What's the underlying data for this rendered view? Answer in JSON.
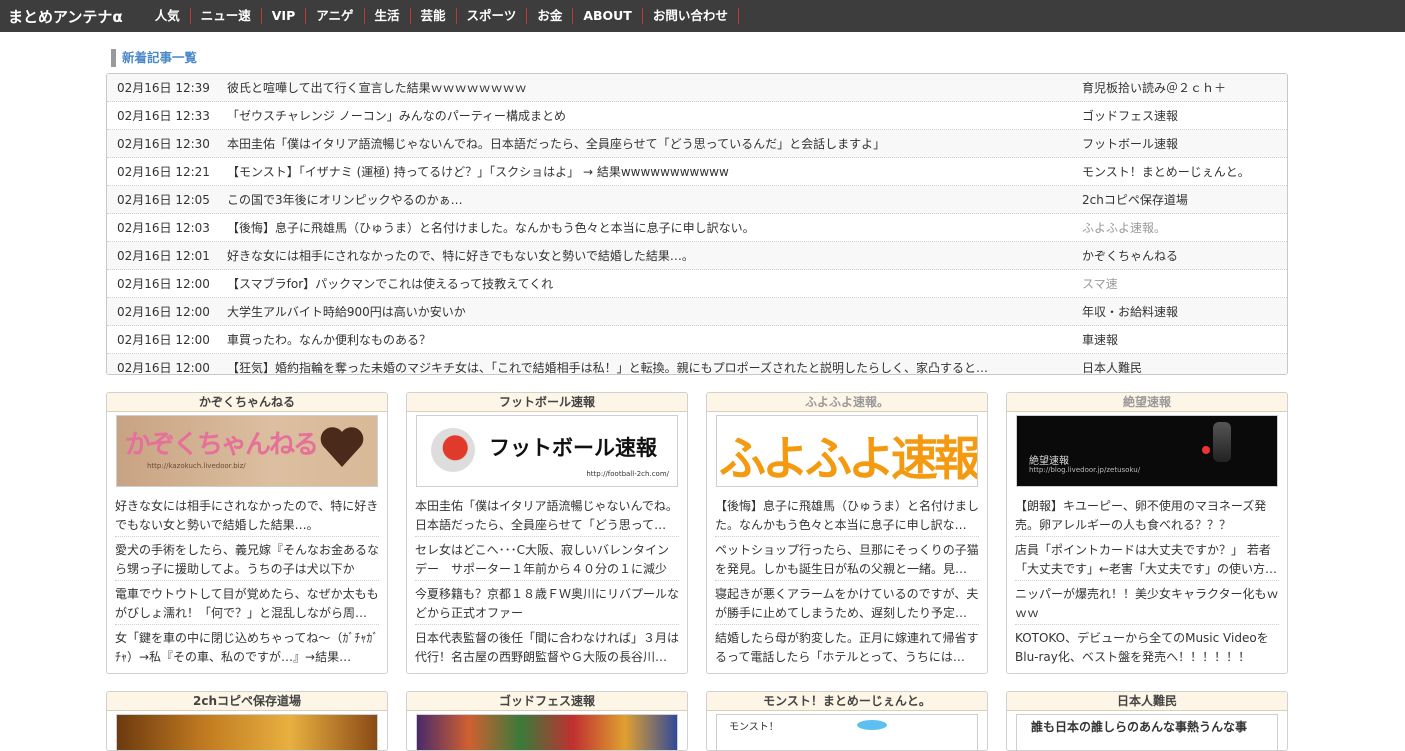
{
  "header": {
    "logo": "まとめアンテナα",
    "nav": [
      "人気",
      "ニュー速",
      "VIP",
      "アニゲ",
      "生活",
      "芸能",
      "スポーツ",
      "お金",
      "ABOUT",
      "お問い合わせ"
    ]
  },
  "section_title": "新着記事一覧",
  "news": [
    {
      "time": "02月16日 12:39",
      "title": "彼氏と喧嘩して出て行く宣言した結果ｗｗｗｗｗｗｗｗ",
      "site": "育児板拾い読み＠２ｃｈ＋"
    },
    {
      "time": "02月16日 12:33",
      "title": "「ゼウスチャレンジ ノーコン」みんなのパーティー構成まとめ",
      "site": "ゴッドフェス速報"
    },
    {
      "time": "02月16日 12:30",
      "title": "本田圭佑「僕はイタリア語流暢じゃないんでね。日本語だったら、全員座らせて「どう思っているんだ」と会話しますよ」",
      "site": "フットボール速報"
    },
    {
      "time": "02月16日 12:21",
      "title": "【モンスト】「イザナミ (運極) 持ってるけど？」「スクショはよ」 → 結果wwwwwwwwwww",
      "site": "モンスト！まとめーじぇんと。"
    },
    {
      "time": "02月16日 12:05",
      "title": "この国で3年後にオリンピックやるのかぁ…",
      "site": "2chコピペ保存道場"
    },
    {
      "time": "02月16日 12:03",
      "title": "【後悔】息子に飛雄馬（ひゅうま）と名付けました。なんかもう色々と本当に息子に申し訳ない。",
      "site": "ふよふよ速報。"
    },
    {
      "time": "02月16日 12:01",
      "title": "好きな女には相手にされなかったので、特に好きでもない女と勢いで結婚した結果…。",
      "site": "かぞくちゃんねる"
    },
    {
      "time": "02月16日 12:00",
      "title": "【スマブラfor】パックマンでこれは使えるって技教えてくれ",
      "site": "スマ速"
    },
    {
      "time": "02月16日 12:00",
      "title": "大学生アルバイト時給900円は高いか安いか",
      "site": "年収・お給料速報"
    },
    {
      "time": "02月16日 12:00",
      "title": "車買ったわ。なんか便利なものある？",
      "site": "車速報"
    },
    {
      "time": "02月16日 12:00",
      "title": "【狂気】婚約指輪を奪った未婚のマジキチ女は、「これで結婚相手は私！」と転換。親にもプロポーズされたと説明したらしく、家凸すると…",
      "site": "日本人難民"
    }
  ],
  "cards": [
    {
      "name": "かぞくちゃんねる",
      "banner_text": "かぞくちゃんねる",
      "banner_url": "http://kazokuch.livedoor.biz/",
      "items": [
        "好きな女には相手にされなかったので、特に好きでもない女と勢いで結婚した結果…。",
        "愛犬の手術をしたら、義兄嫁『そんなお金あるなら甥っ子に援助してよ。うちの子は犬以下か",
        "電車でウトウトして目が覚めたら、なぜか太ももがびしょ濡れ！「何で？」と混乱しながら周…",
        "女「鍵を車の中に閉じ込めちゃってね～（ｶﾞﾁｬｶﾞﾁｬ）→私『その車、私のですが…』→結果…"
      ]
    },
    {
      "name": "フットボール速報",
      "banner_text": "フットボール速報",
      "banner_url": "http://football-2ch.com/",
      "items": [
        "本田圭佑「僕はイタリア語流暢じゃないんでね。日本語だったら、全員座らせて「どう思って…",
        "セレ女はどこへ･･･C大阪、寂しいバレンタインデー　サポーター１年前から４０分の１に減少",
        "今夏移籍も？京都１８歳ＦＷ奥川にリバプールなどから正式オファー",
        "日本代表監督の後任「間に合わなければ」３月は代行！名古屋の西野朗監督やＧ大阪の長谷川…"
      ]
    },
    {
      "name": "ふよふよ速報。",
      "banner_text": "ふよふよ速報。",
      "items": [
        "【後悔】息子に飛雄馬（ひゅうま）と名付けました。なんかもう色々と本当に息子に申し訳な…",
        "ペットショップ行ったら、旦那にそっくりの子猫を発見。しかも誕生日が私の父親と一緒。見…",
        "寝起きが悪くアラームをかけているのですが、夫が勝手に止めてしまうため、遅刻したり予定…",
        "結婚したら母が豹変した。正月に嫁連れて帰省するって電話したら「ホテルとって、うちには…"
      ]
    },
    {
      "name": "絶望速報",
      "banner_text": "絶望速報",
      "banner_url": "http://blog.livedoor.jp/zetusoku/",
      "items": [
        "【朗報】キユーピー、卵不使用のマヨネーズ発売。卵アレルギーの人も食べれる？？？",
        "店員「ポイントカードは大丈夫ですか？」 若者「大丈夫です」←老害「大丈夫です」の使い方…",
        "ニッパーが爆売れ！！美少女キャラクター化もｗｗｗ",
        "KOTOKO、デビューから全てのMusic VideoをBlu-ray化、ベスト盤を発売へ！！！！！！"
      ]
    },
    {
      "name": "2chコピペ保存道場"
    },
    {
      "name": "ゴッドフェス速報"
    },
    {
      "name": "モンスト！まとめーじぇんと。",
      "banner_text": "モンスト！"
    },
    {
      "name": "日本人難民",
      "banner_text": "誰も日本の誰しらのあんな事熱うんな事"
    }
  ],
  "colors": {
    "nav_bg": "#3d3d3d",
    "nav_sep": "#c0392b",
    "title_blue": "#4a88c8",
    "card_head_bg": "#fdf6e6",
    "muted_site": "#9a9a9a"
  }
}
